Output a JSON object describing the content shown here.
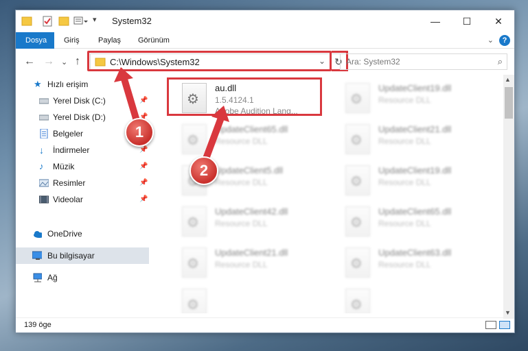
{
  "window": {
    "title": "System32",
    "controls": {
      "minimize": "—",
      "maximize": "☐",
      "close": "✕"
    }
  },
  "ribbon": {
    "tabs": [
      {
        "label": "Dosya",
        "active": true
      },
      {
        "label": "Giriş",
        "active": false
      },
      {
        "label": "Paylaş",
        "active": false
      },
      {
        "label": "Görünüm",
        "active": false
      }
    ],
    "help": "?"
  },
  "address": {
    "path": "C:\\Windows\\System32"
  },
  "search": {
    "placeholder": "Ara: System32"
  },
  "sidebar": {
    "items": [
      {
        "label": "Hızlı erişim",
        "icon": "star-icon",
        "pinned": false,
        "selected": false
      },
      {
        "label": "Yerel Disk (C:)",
        "icon": "drive-icon",
        "pinned": true,
        "selected": false
      },
      {
        "label": "Yerel Disk (D:)",
        "icon": "drive-icon",
        "pinned": true,
        "selected": false
      },
      {
        "label": "Belgeler",
        "icon": "documents-icon",
        "pinned": true,
        "selected": false
      },
      {
        "label": "İndirmeler",
        "icon": "download-icon",
        "pinned": true,
        "selected": false
      },
      {
        "label": "Müzik",
        "icon": "music-icon",
        "pinned": true,
        "selected": false
      },
      {
        "label": "Resimler",
        "icon": "pictures-icon",
        "pinned": true,
        "selected": false
      },
      {
        "label": "Videolar",
        "icon": "videos-icon",
        "pinned": true,
        "selected": false
      },
      {
        "label": "OneDrive",
        "icon": "cloud-icon",
        "pinned": false,
        "selected": false
      },
      {
        "label": "Bu bilgisayar",
        "icon": "computer-icon",
        "pinned": false,
        "selected": true
      },
      {
        "label": "Ağ",
        "icon": "network-icon",
        "pinned": false,
        "selected": false
      }
    ]
  },
  "files": [
    {
      "name": "au.dll",
      "version": "1.5.4124.1",
      "desc": "Adobe Audition Lang...",
      "highlighted": true
    },
    {
      "name": "UpdateClient19.dll",
      "desc": "Resource DLL"
    },
    {
      "name": "UpdateClient65.dll",
      "desc": "Resource DLL"
    },
    {
      "name": "UpdateClient21.dll",
      "desc": "Resource DLL"
    },
    {
      "name": "UpdateClient5.dll",
      "desc": "Resource DLL"
    },
    {
      "name": "UpdateClient19.dll",
      "desc": "Resource DLL"
    },
    {
      "name": "UpdateClient42.dll",
      "desc": "Resource DLL"
    },
    {
      "name": "UpdateClient65.dll",
      "desc": "Resource DLL"
    },
    {
      "name": "UpdateClient21.dll",
      "desc": "Resource DLL"
    },
    {
      "name": "UpdateClient63.dll",
      "desc": "Resource DLL"
    }
  ],
  "status": {
    "count": "139 öge"
  },
  "annotations": {
    "step1": "1",
    "step2": "2"
  },
  "colors": {
    "accent": "#1979ca",
    "highlight": "#d9383e",
    "selection": "#dde3ea"
  }
}
